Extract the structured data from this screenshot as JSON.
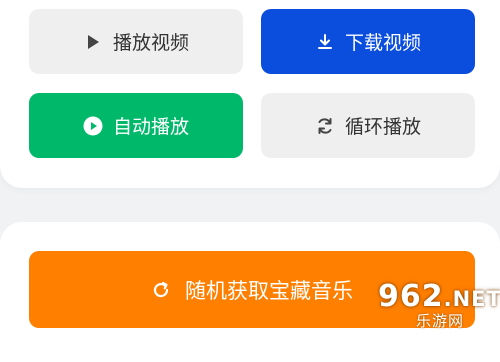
{
  "controls": {
    "play_video": {
      "label": "播放视频",
      "icon": "play-icon"
    },
    "download_video": {
      "label": "下载视频",
      "icon": "download-icon"
    },
    "auto_play": {
      "label": "自动播放",
      "icon": "play-circle-icon"
    },
    "loop_play": {
      "label": "循环播放",
      "icon": "loop-icon"
    }
  },
  "random_music": {
    "label": "随机获取宝藏音乐",
    "icon": "refresh-icon"
  },
  "watermark": {
    "brand": "962",
    "suffix": ".NET",
    "subtitle": "乐游网"
  },
  "colors": {
    "download_blue": "#0b4ede",
    "auto_green": "#00b86a",
    "random_orange": "#ff7f00",
    "neutral_button": "#efefef"
  }
}
